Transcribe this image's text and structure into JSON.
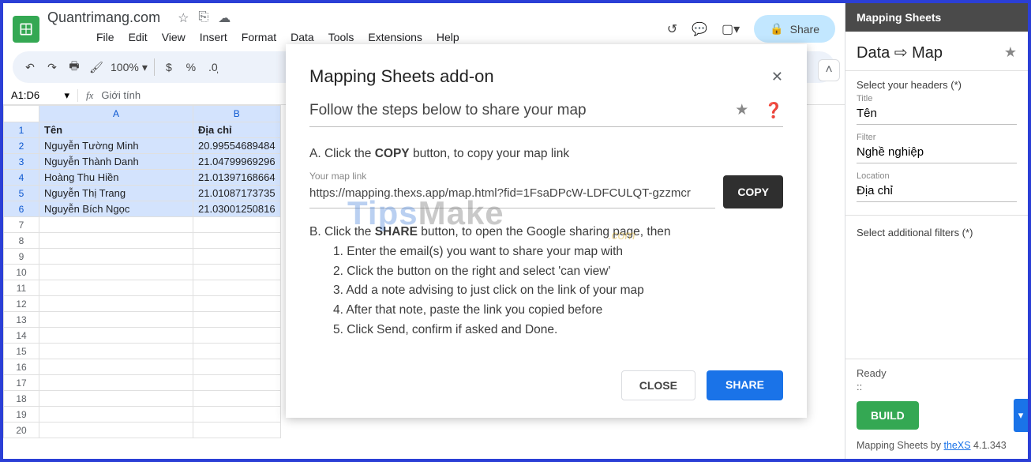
{
  "doc": {
    "title": "Quantrimang.com"
  },
  "menu": {
    "file": "File",
    "edit": "Edit",
    "view": "View",
    "insert": "Insert",
    "format": "Format",
    "data": "Data",
    "tools": "Tools",
    "extensions": "Extensions",
    "help": "Help"
  },
  "header": {
    "share": "Share"
  },
  "toolbar": {
    "zoom": "100%",
    "currency": "$",
    "percent": "%"
  },
  "namebox": {
    "ref": "A1:D6",
    "formula": "Giới tính"
  },
  "columns": {
    "A": "A",
    "B": "B"
  },
  "rows": [
    {
      "n": "1",
      "a": "Tên",
      "b": "Địa chỉ",
      "hdr": true
    },
    {
      "n": "2",
      "a": "Nguyễn Tường Minh",
      "b": "20.99554689484"
    },
    {
      "n": "3",
      "a": "Nguyễn Thành Danh",
      "b": "21.04799969296"
    },
    {
      "n": "4",
      "a": "Hoàng Thu Hiền",
      "b": "21.01397168664"
    },
    {
      "n": "5",
      "a": "Nguyễn Thị Trang",
      "b": "21.01087173735"
    },
    {
      "n": "6",
      "a": "Nguyễn Bích Ngọc",
      "b": "21.03001250816"
    },
    {
      "n": "7",
      "a": "",
      "b": ""
    },
    {
      "n": "8",
      "a": "",
      "b": ""
    },
    {
      "n": "9",
      "a": "",
      "b": ""
    },
    {
      "n": "10",
      "a": "",
      "b": ""
    },
    {
      "n": "11",
      "a": "",
      "b": ""
    },
    {
      "n": "12",
      "a": "",
      "b": ""
    },
    {
      "n": "13",
      "a": "",
      "b": ""
    },
    {
      "n": "14",
      "a": "",
      "b": ""
    },
    {
      "n": "15",
      "a": "",
      "b": ""
    },
    {
      "n": "16",
      "a": "",
      "b": ""
    },
    {
      "n": "17",
      "a": "",
      "b": ""
    },
    {
      "n": "18",
      "a": "",
      "b": ""
    },
    {
      "n": "19",
      "a": "",
      "b": ""
    },
    {
      "n": "20",
      "a": "",
      "b": ""
    }
  ],
  "modal": {
    "title": "Mapping Sheets add-on",
    "subtitle": "Follow the steps below to share your map",
    "stepA_pre": "A. Click the ",
    "stepA_bold": "COPY",
    "stepA_post": " button, to copy your map link",
    "link_label": "Your map link",
    "link_value": "https://mapping.thexs.app/map.html?fid=1FsaDPcW-LDFCULQT-gzzmcr",
    "copy": "COPY",
    "stepB_pre": "B. Click the ",
    "stepB_bold": "SHARE",
    "stepB_post": " button, to open the Google sharing page, then",
    "b1": "1. Enter the email(s) you want to share your map with",
    "b2": "2. Click the button on the right and select 'can view'",
    "b3": "3. Add a note advising to just click on the link of your map",
    "b4": "4. After that note, paste the link you copied before",
    "b5": "5. Click Send, confirm if asked and Done.",
    "close": "CLOSE",
    "share": "SHARE"
  },
  "sidebar": {
    "header": "Mapping Sheets",
    "title": "Data ⇨ Map",
    "select_headers": "Select your headers (*)",
    "title_lbl": "Title",
    "title_val": "Tên",
    "filter_lbl": "Filter",
    "filter_val": "Nghề nghiệp",
    "location_lbl": "Location",
    "location_val": "Địa chỉ",
    "additional": "Select additional filters (*)",
    "ready": "Ready",
    "dots": "::",
    "build": "BUILD",
    "credits_pre": "Mapping Sheets by ",
    "credits_link": "theXS",
    "credits_ver": " 4.1.343"
  },
  "watermark": {
    "brand1": "Tips",
    "brand2": "Make",
    "sub": ".com"
  }
}
